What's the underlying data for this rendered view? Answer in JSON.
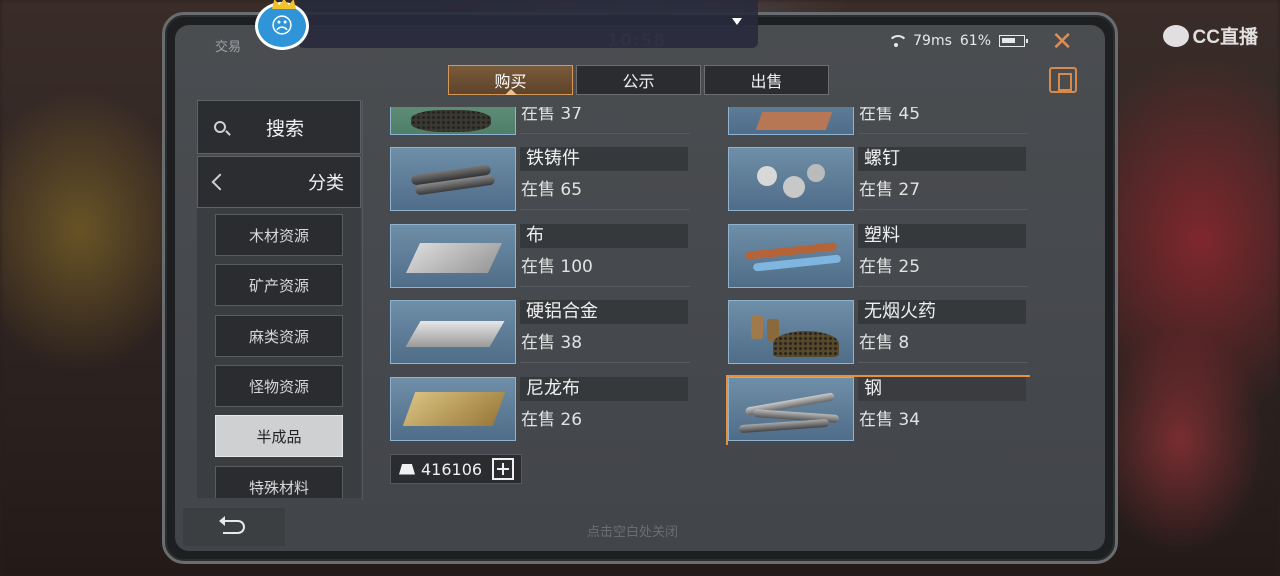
{
  "header": {
    "title": "交易",
    "clock": "10:58",
    "ping": "79ms",
    "battery": "61%",
    "watermark": "CC直播"
  },
  "tabs": [
    {
      "label": "购买",
      "active": true
    },
    {
      "label": "公示",
      "active": false
    },
    {
      "label": "出售",
      "active": false
    }
  ],
  "sidebar": {
    "search_label": "搜索",
    "category_label": "分类",
    "categories": [
      {
        "label": "木材资源",
        "active": false
      },
      {
        "label": "矿产资源",
        "active": false
      },
      {
        "label": "麻类资源",
        "active": false
      },
      {
        "label": "怪物资源",
        "active": false
      },
      {
        "label": "半成品",
        "active": true
      },
      {
        "label": "特殊材料",
        "active": false
      }
    ]
  },
  "items": [
    {
      "name": "",
      "stock": "在售 37",
      "icon": "granules-icon"
    },
    {
      "name": "",
      "stock": "在售 45",
      "icon": "copper-icon"
    },
    {
      "name": "铁铸件",
      "stock": "在售 65",
      "icon": "iron-casting-icon"
    },
    {
      "name": "螺钉",
      "stock": "在售 27",
      "icon": "screw-icon"
    },
    {
      "name": "布",
      "stock": "在售 100",
      "icon": "cloth-icon"
    },
    {
      "name": "塑料",
      "stock": "在售 25",
      "icon": "plastic-icon"
    },
    {
      "name": "硬铝合金",
      "stock": "在售 38",
      "icon": "duralumin-icon"
    },
    {
      "name": "无烟火药",
      "stock": "在售 8",
      "icon": "gunpowder-icon"
    },
    {
      "name": "尼龙布",
      "stock": "在售 26",
      "icon": "nylon-icon"
    },
    {
      "name": "钢",
      "stock": "在售 34",
      "icon": "steel-icon",
      "selected": true
    }
  ],
  "currency": {
    "value": "416106"
  },
  "hint": "点击空白处关闭",
  "colors": {
    "accent": "#e5913f",
    "tab_active": "#6b4e33",
    "panel": "#4a4d50"
  }
}
